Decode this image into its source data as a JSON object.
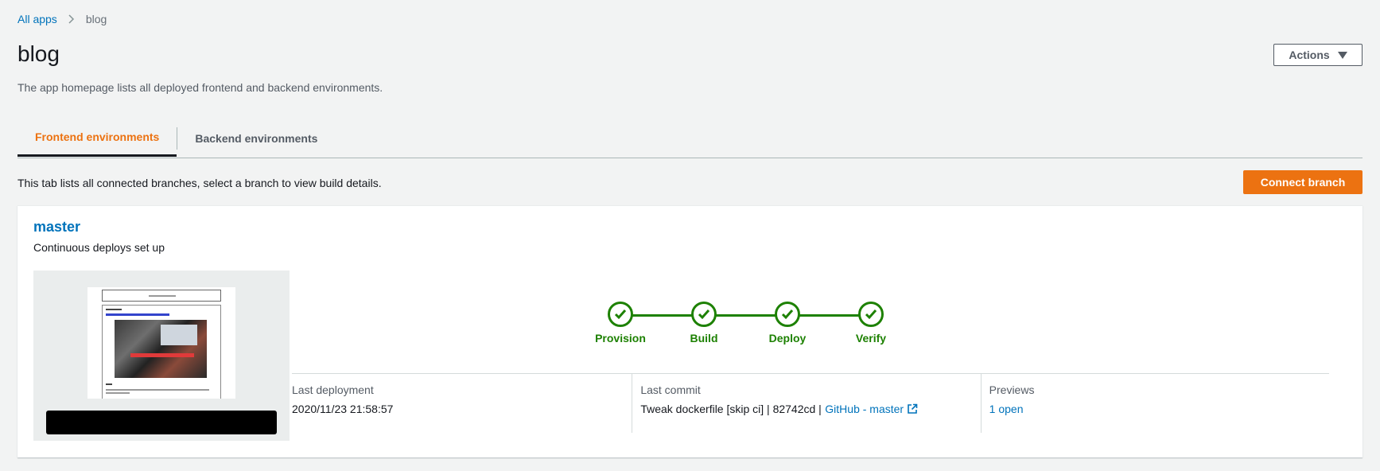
{
  "breadcrumb": {
    "root": "All apps",
    "current": "blog"
  },
  "page": {
    "title": "blog",
    "description": "The app homepage lists all deployed frontend and backend environments.",
    "actions_label": "Actions"
  },
  "tabs": [
    {
      "label": "Frontend environments",
      "active": true
    },
    {
      "label": "Backend environments",
      "active": false
    }
  ],
  "tab_description": "This tab lists all connected branches, select a branch to view build details.",
  "connect_branch_label": "Connect branch",
  "branch": {
    "name": "master",
    "subtitle": "Continuous deploys set up",
    "steps": [
      "Provision",
      "Build",
      "Deploy",
      "Verify"
    ],
    "last_deployment_label": "Last deployment",
    "last_deployment_value": "2020/11/23 21:58:57",
    "last_commit_label": "Last commit",
    "last_commit_message": "Tweak dockerfile [skip ci] | 82742cd |",
    "last_commit_link": "GitHub - master",
    "previews_label": "Previews",
    "previews_value": "1 open"
  },
  "icons": {
    "breadcrumb_separator": "chevron-right-icon",
    "actions_caret": "caret-down-icon",
    "step_status": "check-circle-icon",
    "external_link": "external-link-icon"
  },
  "colors": {
    "accent": "#ec7211",
    "link": "#0073bb",
    "success": "#1d8102",
    "background": "#f2f3f3"
  }
}
